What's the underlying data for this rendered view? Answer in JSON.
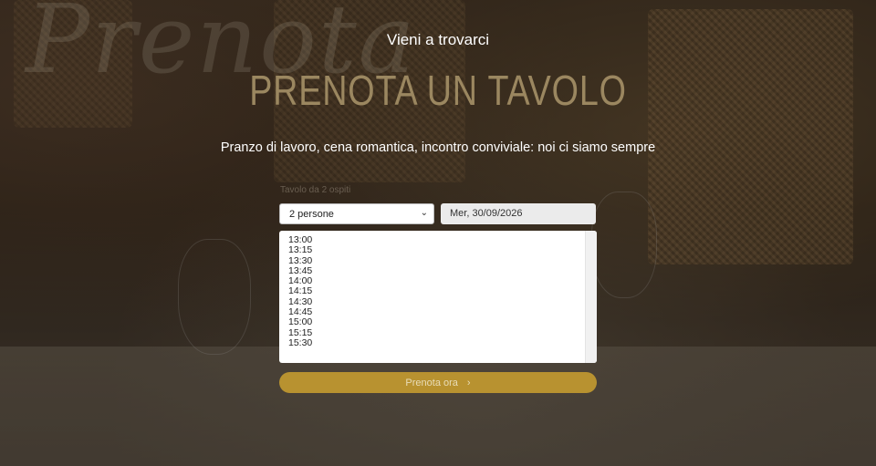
{
  "header": {
    "script_word": "Prenota",
    "eyebrow": "Vieni a trovarci",
    "title": "PRENOTA UN TAVOLO",
    "subtitle": "Pranzo di lavoro, cena romantica, incontro conviviale: noi ci siamo sempre"
  },
  "form": {
    "label": "Tavolo da 2 ospiti",
    "guests_value": "2 persone",
    "date_value": "Mer, 30/09/2026",
    "times": [
      "13:00",
      "13:15",
      "13:30",
      "13:45",
      "14:00",
      "14:15",
      "14:30",
      "14:45",
      "15:00",
      "15:15",
      "15:30"
    ],
    "submit_label": "Prenota ora"
  },
  "colors": {
    "accent": "#b89230",
    "title": "#9b8760"
  }
}
